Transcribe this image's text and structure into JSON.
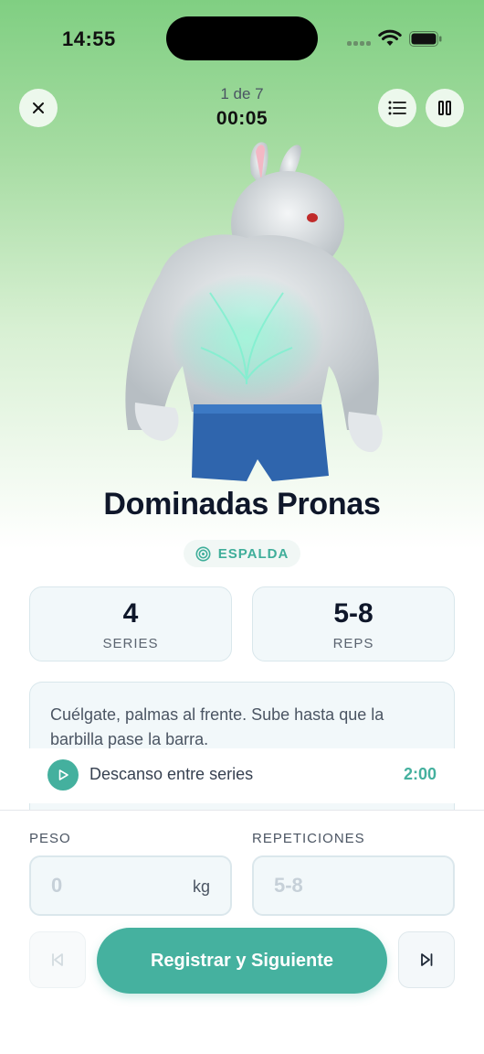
{
  "status_bar": {
    "time": "14:55"
  },
  "header": {
    "progress": "1 de 7",
    "timer": "00:05",
    "close_icon": "close-icon",
    "list_icon": "list-icon",
    "pause_icon": "pause-icon"
  },
  "exercise": {
    "name": "Dominadas Pronas",
    "muscle_group": "ESPALDA",
    "muscle_icon": "target-icon",
    "series_value": "4",
    "series_label": "SERIES",
    "reps_value": "5-8",
    "reps_label": "REPS",
    "description": "Cuélgate, palmas al frente. Sube hasta que la barbilla pase la barra.",
    "rest_label": "Descanso entre series",
    "rest_value": "2:00",
    "rest_icon": "play-icon"
  },
  "form": {
    "weight_label": "PESO",
    "weight_placeholder": "0",
    "weight_unit": "kg",
    "reps_label": "REPETICIONES",
    "reps_placeholder": "5-8"
  },
  "actions": {
    "previous_icon": "skip-previous-icon",
    "submit_label": "Registrar y Siguiente",
    "next_icon": "skip-next-icon"
  },
  "colors": {
    "accent": "#45b19f",
    "gradient_top": "#80cf82",
    "title": "#0f172a"
  }
}
